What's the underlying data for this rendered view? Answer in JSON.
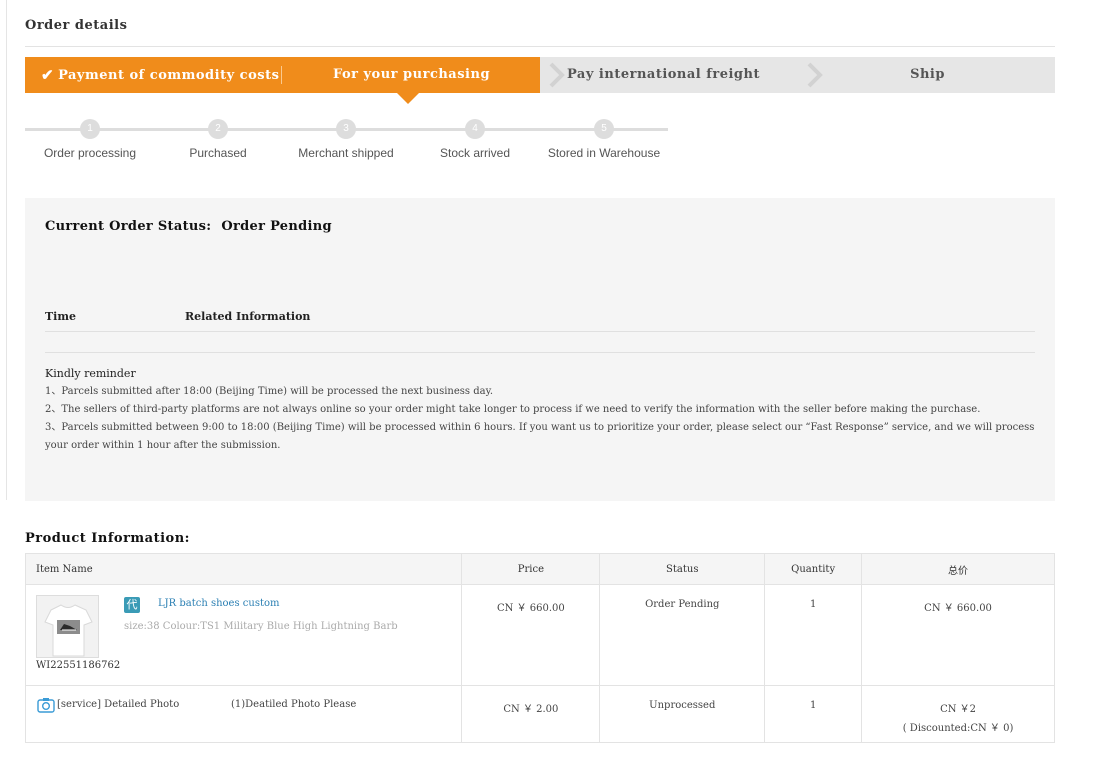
{
  "page": {
    "title": "Order details"
  },
  "steps": [
    {
      "label": "Payment of commodity costs",
      "state": "done"
    },
    {
      "label": "For your purchasing",
      "state": "current"
    },
    {
      "label": "Pay international freight",
      "state": "pending"
    },
    {
      "label": "Ship",
      "state": "pending"
    }
  ],
  "progress": [
    {
      "num": "1",
      "label": "Order processing"
    },
    {
      "num": "2",
      "label": "Purchased"
    },
    {
      "num": "3",
      "label": "Merchant shipped"
    },
    {
      "num": "4",
      "label": "Stock arrived"
    },
    {
      "num": "5",
      "label": "Stored in Warehouse"
    }
  ],
  "status": {
    "label": "Current Order Status:",
    "value": "Order Pending",
    "col_time": "Time",
    "col_info": "Related Information"
  },
  "reminder": {
    "title": "Kindly reminder",
    "lines": [
      "1、Parcels submitted after 18:00 (Beijing Time) will be processed the next business day.",
      "2、The sellers of third-party platforms are not always online so your order might take longer to process if we need to verify the information with the seller before making the purchase.",
      "3、Parcels submitted between 9:00 to 18:00 (Beijing Time) will be processed within 6 hours. If you want us to prioritize your order, please select our “Fast Response” service, and we will process your order within 1 hour after the submission."
    ]
  },
  "products": {
    "title": "Product Information:",
    "headers": {
      "name": "Item Name",
      "price": "Price",
      "status": "Status",
      "quantity": "Quantity",
      "total": "总价"
    },
    "items": [
      {
        "badge": "代",
        "name": "LJR batch shoes custom",
        "spec": "size:38 Colour:TS1 Military Blue High Lightning Barb",
        "id": "WI22551186762",
        "price": "CN ￥ 660.00",
        "status": "Order Pending",
        "quantity": "1",
        "total": "CN ￥ 660.00"
      }
    ],
    "service": {
      "name": "[service] Detailed Photo",
      "detail": "(1)Deatiled Photo Please",
      "price": "CN ￥ 2.00",
      "status": "Unprocessed",
      "quantity": "1",
      "total": "CN ￥2",
      "total_note": "( Discounted:CN ￥ 0)"
    }
  },
  "colors": {
    "accent": "#f08c1b",
    "link": "#2a7fb3",
    "badge": "#3a9bb6"
  },
  "icons": [
    "check-icon",
    "chevron-right-icon",
    "camera-icon",
    "dai-purchase-icon"
  ]
}
